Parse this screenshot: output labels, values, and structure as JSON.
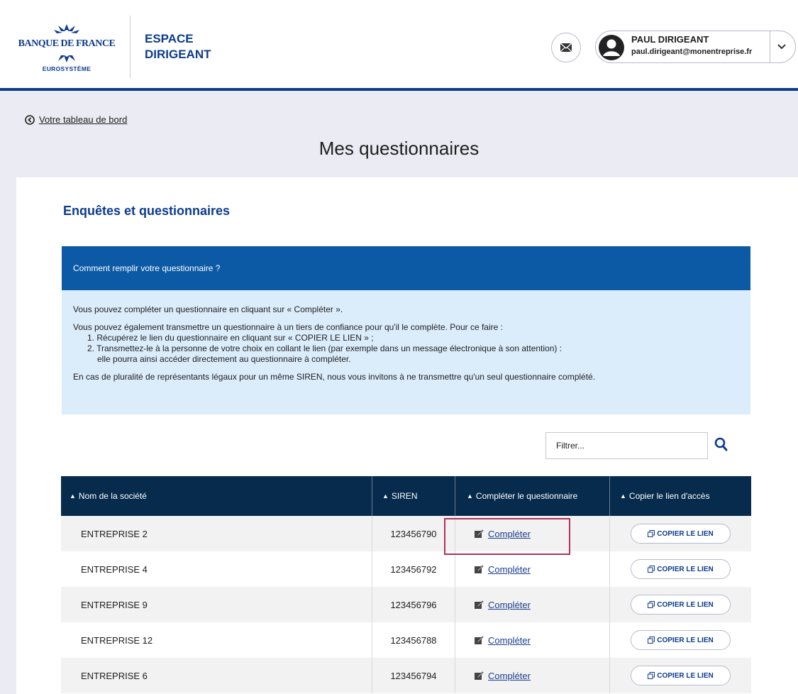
{
  "header": {
    "logo": {
      "main": "BANQUE DE FRANCE",
      "sub": "EUROSYSTÈME"
    },
    "espace_line1": "ESPACE",
    "espace_line2": "DIRIGEANT",
    "user": {
      "name": "PAUL DIRIGEANT",
      "email": "paul.dirigeant@monentreprise.fr"
    }
  },
  "back_link": "Votre tableau de bord",
  "page_title": "Mes questionnaires",
  "section_title": "Enquêtes et questionnaires",
  "info": {
    "heading": "Comment remplir votre questionnaire ?",
    "p1": "Vous pouvez compléter un questionnaire en cliquant sur « Compléter ».",
    "p2": "Vous pouvez également transmettre un questionnaire à un tiers de confiance pour qu'il le complète. Pour ce faire :",
    "step1": "1. Récupérez le lien du questionnaire en cliquant sur « COPIER LE LIEN » ;",
    "step2": "2. Transmettez-le à la personne de votre choix en collant le lien (par exemple dans un message électronique à son attention) :",
    "step2b": "elle pourra ainsi accéder directement au questionnaire à compléter.",
    "p3": "En cas de pluralité de représentants légaux pour un même SIREN, nous vous invitons à ne transmettre qu'un seul questionnaire complété."
  },
  "filter": {
    "placeholder": "Filtrer..."
  },
  "table": {
    "headers": [
      "Nom de la société",
      "SIREN",
      "Compléter le questionnaire",
      "Copier le lien d'accès"
    ],
    "action_label": "Compléter",
    "copy_label": "COPIER LE LIEN",
    "rows": [
      {
        "name": "ENTREPRISE 2",
        "siren": "123456790"
      },
      {
        "name": "ENTREPRISE 4",
        "siren": "123456792"
      },
      {
        "name": "ENTREPRISE 9",
        "siren": "123456796"
      },
      {
        "name": "ENTREPRISE 12",
        "siren": "123456788"
      },
      {
        "name": "ENTREPRISE 6",
        "siren": "123456794"
      }
    ]
  },
  "colors": {
    "brand": "#0d3b8c",
    "info_head": "#0c5aa6",
    "table_head": "#062b4d",
    "highlight": "#b03060"
  }
}
